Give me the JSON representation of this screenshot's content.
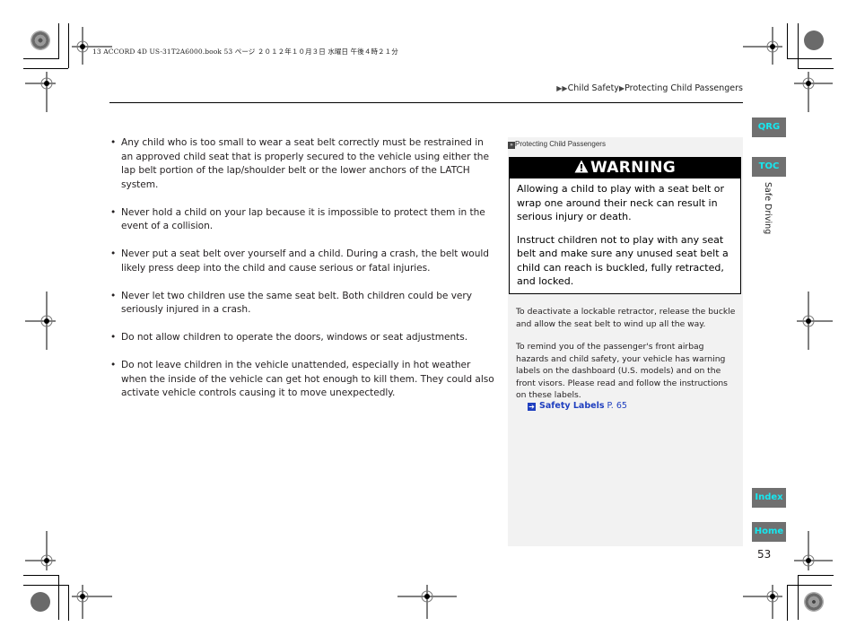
{
  "print_header": {
    "file_info": "13 ACCORD 4D US-31T2A6000.book  53 ページ  ２０１２年１０月３日  水曜日  午後４時２１分"
  },
  "breadcrumb": {
    "prefix_icon": "double-triangle-right-icon",
    "items": [
      "Child Safety",
      "Protecting Child Passengers"
    ],
    "separator_icon": "triangle-right-icon"
  },
  "main": {
    "bullets": [
      "Any child who is too small to wear a seat belt correctly must be restrained in an approved child seat that is properly secured to the vehicle using either the lap belt portion of the lap/shoulder belt or the lower anchors of the LATCH system.",
      "Never hold a child on your lap because it is impossible to protect them in the event of a collision.",
      "Never put a seat belt over yourself and a child. During a crash, the belt would likely press deep into the child and cause serious or fatal injuries.",
      "Never let two children use the same seat belt. Both children could be very seriously injured in a crash.",
      "Do not allow children to operate the doors, windows or seat adjustments.",
      "Do not leave children in the vehicle unattended, especially in hot weather when the inside of the vehicle can get hot enough to kill them. They could also activate vehicle controls causing it to move unexpectedly."
    ],
    "bullet_glyph": "•"
  },
  "side_panel": {
    "title_icon": "double-chevron-right-icon",
    "title": "Protecting Child Passengers",
    "warning": {
      "icon": "warning-triangle-icon",
      "heading": "WARNING",
      "paragraphs": [
        "Allowing a child to play with a seat belt or wrap one around their neck can result in serious injury or death.",
        "Instruct children not to play with any seat belt and make sure any unused seat belt a child can reach is buckled, fully retracted, and locked."
      ]
    },
    "notes": [
      "To deactivate a lockable retractor, release the buckle and allow the seat belt to wind up all the way.",
      "To remind you of the passenger's front airbag hazards and child safety, your vehicle has warning labels on the dashboard (U.S. models) and on the front visors. Please read and follow the instructions on these labels."
    ],
    "cross_reference": {
      "icon": "arrow-right-box-icon",
      "label": "Safety Labels",
      "page": "P. 65"
    }
  },
  "nav": {
    "qrg": "QRG",
    "toc": "TOC",
    "index": "Index",
    "home": "Home",
    "section_label": "Safe Driving",
    "button_text_color": "#16e8f0",
    "button_bg_color": "#707070"
  },
  "page_number": "53",
  "colors": {
    "link": "#1f3fbf",
    "panel_bg": "#f2f2f2",
    "warning_header_bg": "#000000"
  }
}
